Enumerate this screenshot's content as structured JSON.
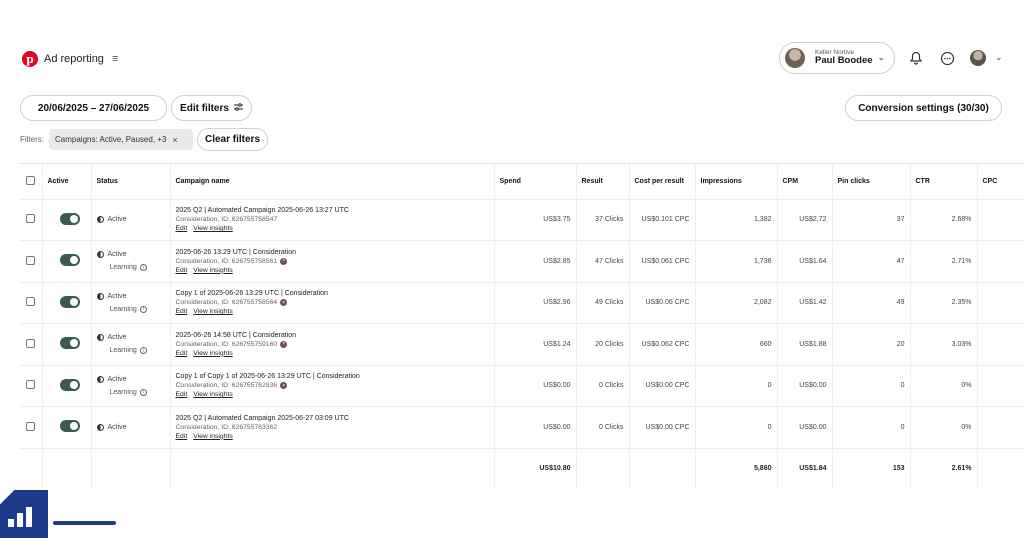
{
  "header": {
    "brand_title": "Ad reporting",
    "account_label": "Keller Nortive",
    "account_name": "Paul Boodee"
  },
  "toolbar": {
    "date_range": "20/06/2025 – 27/06/2025",
    "edit_filters_label": "Edit filters",
    "conversion_settings_label": "Conversion settings (30/30)",
    "filters_label": "Filters:",
    "filter_chip": "Campaigns: Active, Paused, +3",
    "clear_filters_label": "Clear filters"
  },
  "table": {
    "columns": [
      "Active",
      "Status",
      "Campaign name",
      "Spend",
      "Result",
      "Cost per result",
      "Impressions",
      "CPM",
      "Pin clicks",
      "CTR",
      "CPC"
    ],
    "rows": [
      {
        "status": "Active",
        "learning": "",
        "name": "2025 Q2 | Automated Campaign 2025-06-26 13:27 UTC",
        "sub": "Consideration, ID: 626755758547",
        "warning": false,
        "edit": "Edit",
        "insights": "View insights",
        "spend": "US$3.75",
        "result": "37 Clicks",
        "cpr": "US$0.101 CPC",
        "impressions": "1,382",
        "cpm": "US$2.72",
        "pin_clicks": "37",
        "ctr": "2.68%"
      },
      {
        "status": "Active",
        "learning": "Learning",
        "name": "2025-06-26 13:29 UTC | Consideration",
        "sub": "Consideration, ID: 626755758561",
        "warning": true,
        "edit": "Edit",
        "insights": "View insights",
        "spend": "US$2.85",
        "result": "47 Clicks",
        "cpr": "US$0.061 CPC",
        "impressions": "1,736",
        "cpm": "US$1.64",
        "pin_clicks": "47",
        "ctr": "2.71%"
      },
      {
        "status": "Active",
        "learning": "Learning",
        "name": "Copy 1 of 2025-06-26 13:29 UTC | Consideration",
        "sub": "Consideration, ID: 626755758564",
        "warning": true,
        "edit": "Edit",
        "insights": "View insights",
        "spend": "US$2.96",
        "result": "49 Clicks",
        "cpr": "US$0.06 CPC",
        "impressions": "2,082",
        "cpm": "US$1.42",
        "pin_clicks": "49",
        "ctr": "2.35%"
      },
      {
        "status": "Active",
        "learning": "Learning",
        "name": "2025-06-26 14:58 UTC | Consideration",
        "sub": "Consideration, ID: 626755759160",
        "warning": true,
        "edit": "Edit",
        "insights": "View insights",
        "spend": "US$1.24",
        "result": "20 Clicks",
        "cpr": "US$0.062 CPC",
        "impressions": "660",
        "cpm": "US$1.88",
        "pin_clicks": "20",
        "ctr": "3.03%"
      },
      {
        "status": "Active",
        "learning": "Learning",
        "name": "Copy 1 of Copy 1 of 2025-06-26 13:29 UTC | Consideration",
        "sub": "Consideration, ID: 626755762936",
        "warning": true,
        "edit": "Edit",
        "insights": "View insights",
        "spend": "US$0.00",
        "result": "0 Clicks",
        "cpr": "US$0.00 CPC",
        "impressions": "0",
        "cpm": "US$0.00",
        "pin_clicks": "0",
        "ctr": "0%"
      },
      {
        "status": "Active",
        "learning": "",
        "name": "2025 Q2 | Automated Campaign 2025-06-27 03:09 UTC",
        "sub": "Consideration, ID: 626755763362",
        "warning": false,
        "edit": "Edit",
        "insights": "View insights",
        "spend": "US$0.00",
        "result": "0 Clicks",
        "cpr": "US$0.00 CPC",
        "impressions": "0",
        "cpm": "US$0.00",
        "pin_clicks": "0",
        "ctr": "0%"
      }
    ],
    "totals": {
      "spend": "US$10.80",
      "impressions": "5,860",
      "cpm": "US$1.84",
      "pin_clicks": "153",
      "ctr": "2.61%"
    }
  },
  "icons": {
    "brand": "pinterest-icon",
    "menu": "menu-icon",
    "notifications": "bell-icon",
    "messages": "chat-icon",
    "filters": "sliders-icon",
    "status": "half-circle-icon",
    "info": "info-icon",
    "warning": "warning-icon",
    "watermark": "bar-chart-logo-icon"
  },
  "colors": {
    "brand_red": "#e60023",
    "toggle_on": "#3b5b4f",
    "watermark_blue": "#1e3a8a"
  }
}
